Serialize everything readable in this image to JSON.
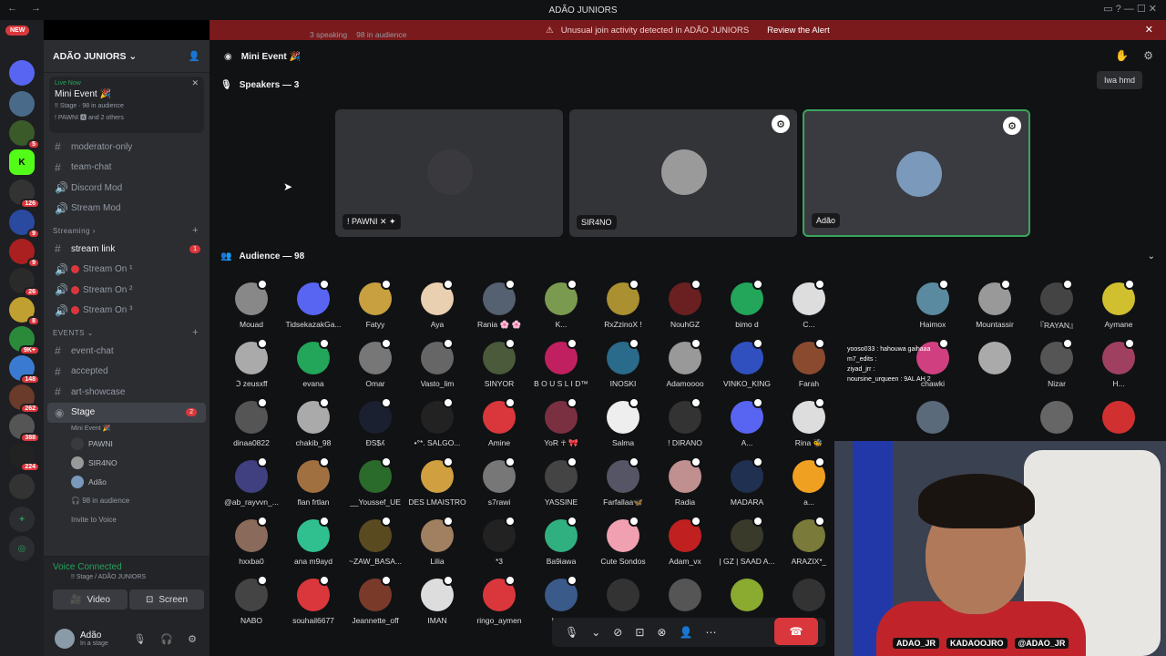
{
  "window": {
    "title": "ADÃO JUNIORS"
  },
  "alert": {
    "text": "Unusual join activity detected in ADÃO JUNIORS",
    "action": "Review the Alert"
  },
  "servers": {
    "new_label": "NEW",
    "badges": [
      "5",
      "5",
      "126",
      "9",
      "9",
      "26",
      "8",
      "9K+",
      "148",
      "262",
      "388",
      "224",
      "9"
    ]
  },
  "guild": {
    "name": "ADÃO JUNIORS"
  },
  "live_event": {
    "status": "Live Now",
    "name": "Mini Event 🎉",
    "stage_line": "!! Stage · 98 in audience",
    "speakers_line": "! PAWNI 🅰 and 2 others"
  },
  "channels": [
    {
      "name": "moderator-only"
    },
    {
      "name": "team-chat"
    },
    {
      "name": "Discord Mod"
    },
    {
      "name": "Stream Mod"
    }
  ],
  "streaming": {
    "label": "Streaming",
    "items": [
      {
        "name": "stream link",
        "badge": "1"
      },
      {
        "name": "Stream On ¹"
      },
      {
        "name": "Stream On ²"
      },
      {
        "name": "Stream On ³"
      }
    ]
  },
  "events": {
    "label": "EVENTS",
    "items": [
      {
        "name": "event-chat"
      },
      {
        "name": "accepted"
      },
      {
        "name": "art-showcase"
      },
      {
        "name": "Stage",
        "badge": "2",
        "sub": "Mini Event 🎉"
      }
    ],
    "stage_users": [
      "PAWNI",
      "SIR4NO",
      "Adão"
    ],
    "audience_text": "98 in audience",
    "invite": "Invite to Voice"
  },
  "voice": {
    "status": "Voice Connected",
    "location": "!! Stage / ADÃO JUNIORS",
    "video": "Video",
    "screen": "Screen"
  },
  "user": {
    "name": "Adão",
    "status": "In a stage"
  },
  "stage": {
    "title": "Mini Event 🎉",
    "speaking": "3 speaking",
    "audience": "98 in audience",
    "speakers_label": "Speakers — 3",
    "speakers": [
      {
        "name": "! PAWNI ✕ ✦",
        "color": "#3a3a3e"
      },
      {
        "name": "SIR4NO",
        "color": "#9a9a9a"
      },
      {
        "name": "Adão",
        "color": "#7a99bb"
      }
    ],
    "audience_label": "Audience — 98",
    "iwa": "Iwa hmd"
  },
  "audience": [
    {
      "name": "Mouad",
      "c": "#888"
    },
    {
      "name": "TidsekazakGa...",
      "c": "#5865f2"
    },
    {
      "name": "Fatyy",
      "c": "#c8a040"
    },
    {
      "name": "Aya",
      "c": "#e8d0b0"
    },
    {
      "name": "Rania 🌸 🌸",
      "c": "#556070"
    },
    {
      "name": "K...",
      "c": "#7a9a50"
    },
    {
      "name": "RxZzinoX !",
      "c": "#aa9030"
    },
    {
      "name": "NouhGZ",
      "c": "#6a2020"
    },
    {
      "name": "bimo d",
      "c": "#23a55a"
    },
    {
      "name": "C...",
      "c": "#ddd"
    },
    {
      "name": "",
      "c": "#111214"
    },
    {
      "name": "Haimox",
      "c": "#5a8aa0"
    },
    {
      "name": "Mountassir",
      "c": "#999"
    },
    {
      "name": "『RAYAN』",
      "c": "#444"
    },
    {
      "name": "Aymane",
      "c": "#d0c030"
    },
    {
      "name": "ℑ zeusxff",
      "c": "#aaa"
    },
    {
      "name": "evana",
      "c": "#23a55a"
    },
    {
      "name": "Omar",
      "c": "#777"
    },
    {
      "name": "Vasto_lim",
      "c": "#666"
    },
    {
      "name": "SINYOR",
      "c": "#4a5a3a"
    },
    {
      "name": "B O U S L I D™",
      "c": "#c02060"
    },
    {
      "name": "INOSKI",
      "c": "#2a6a8a"
    },
    {
      "name": "Adamoooo",
      "c": "#999"
    },
    {
      "name": "VINKO_KING",
      "c": "#3050c0"
    },
    {
      "name": "Farah",
      "c": "#8a4a30"
    },
    {
      "name": "",
      "c": "#111214"
    },
    {
      "name": "chawki",
      "c": "#d04080"
    },
    {
      "name": "",
      "c": "#aaa"
    },
    {
      "name": "Nizar",
      "c": "#555"
    },
    {
      "name": "H...",
      "c": "#a04060"
    },
    {
      "name": "dinaa0822",
      "c": "#555"
    },
    {
      "name": "chakib_98",
      "c": "#aaa"
    },
    {
      "name": "ÐS$ʎ",
      "c": "#1a2030"
    },
    {
      "name": "•°*. SALGO...",
      "c": "#222"
    },
    {
      "name": "Amine",
      "c": "#da373c"
    },
    {
      "name": "YoR ☥ 🎀",
      "c": "#7a3040"
    },
    {
      "name": "Salma",
      "c": "#eee"
    },
    {
      "name": "! DIRANO",
      "c": "#333"
    },
    {
      "name": "A...",
      "c": "#5865f2"
    },
    {
      "name": "Rina 🐝",
      "c": "#ddd"
    },
    {
      "name": "",
      "c": "#111214"
    },
    {
      "name": "",
      "c": "#5a6a7a"
    },
    {
      "name": "",
      "c": "#111214"
    },
    {
      "name": "",
      "c": "#666"
    },
    {
      "name": "",
      "c": "#d03030"
    },
    {
      "name": "@ab_rayvvn_...",
      "c": "#404080"
    },
    {
      "name": "flan frtlan",
      "c": "#a07040"
    },
    {
      "name": "__Youssef_UE",
      "c": "#2a6a2a"
    },
    {
      "name": "DES LMAISTRO",
      "c": "#d0a040"
    },
    {
      "name": "s7rawi",
      "c": "#777"
    },
    {
      "name": "YASSINE",
      "c": "#444"
    },
    {
      "name": "Farfallaa🦋",
      "c": "#556"
    },
    {
      "name": "Radia",
      "c": "#c09090"
    },
    {
      "name": "MADARA",
      "c": "#203050"
    },
    {
      "name": "a...",
      "c": "#f0a020"
    },
    {
      "name": "",
      "c": "#111214"
    },
    {
      "name": "",
      "c": "#111214"
    },
    {
      "name": "",
      "c": "#111214"
    },
    {
      "name": "",
      "c": "#111214"
    },
    {
      "name": "",
      "c": "#111214"
    },
    {
      "name": "hxxba0",
      "c": "#8a6a5a"
    },
    {
      "name": "ana m9ayd",
      "c": "#30c090"
    },
    {
      "name": "~ZAW_BASA...",
      "c": "#5a4a20"
    },
    {
      "name": "Lilia",
      "c": "#a08060"
    },
    {
      "name": "*3",
      "c": "#222"
    },
    {
      "name": "Ba9iawa",
      "c": "#30b080"
    },
    {
      "name": "Cute Sondos",
      "c": "#f0a0b0"
    },
    {
      "name": "Adam_vx",
      "c": "#c02020"
    },
    {
      "name": "| GZ | SAAD A...",
      "c": "#3a3a2a"
    },
    {
      "name": "ARAZIX*_",
      "c": "#7a7a3a"
    },
    {
      "name": "",
      "c": "#111214"
    },
    {
      "name": "",
      "c": "#111214"
    },
    {
      "name": "",
      "c": "#111214"
    },
    {
      "name": "",
      "c": "#111214"
    },
    {
      "name": "",
      "c": "#111214"
    },
    {
      "name": "NABO",
      "c": "#444"
    },
    {
      "name": "souhail6677",
      "c": "#da373c"
    },
    {
      "name": "Jeannette_off",
      "c": "#7a3a2a"
    },
    {
      "name": "IMAN",
      "c": "#ddd"
    },
    {
      "name": "ringo_aymen",
      "c": "#da373c"
    },
    {
      "name": "lamin",
      "c": "#3a5a8a"
    },
    {
      "name": "",
      "c": "#333"
    },
    {
      "name": "",
      "c": "#555"
    },
    {
      "name": "",
      "c": "#8aaa30"
    },
    {
      "name": "",
      "c": "#333"
    },
    {
      "name": "",
      "c": "#111214"
    },
    {
      "name": "",
      "c": "#111214"
    },
    {
      "name": "",
      "c": "#111214"
    },
    {
      "name": "",
      "c": "#111214"
    },
    {
      "name": "",
      "c": "#111214"
    }
  ],
  "overlay_chat": [
    "yooso033 : hahouwa gaihaaa",
    "m7_edits :",
    "ziyad_jrr :",
    "noursine_urqueen : 9AL AH 2"
  ],
  "socials": [
    "ADAO_JR",
    "KADAOOJRO",
    "@ADAO_JR"
  ]
}
